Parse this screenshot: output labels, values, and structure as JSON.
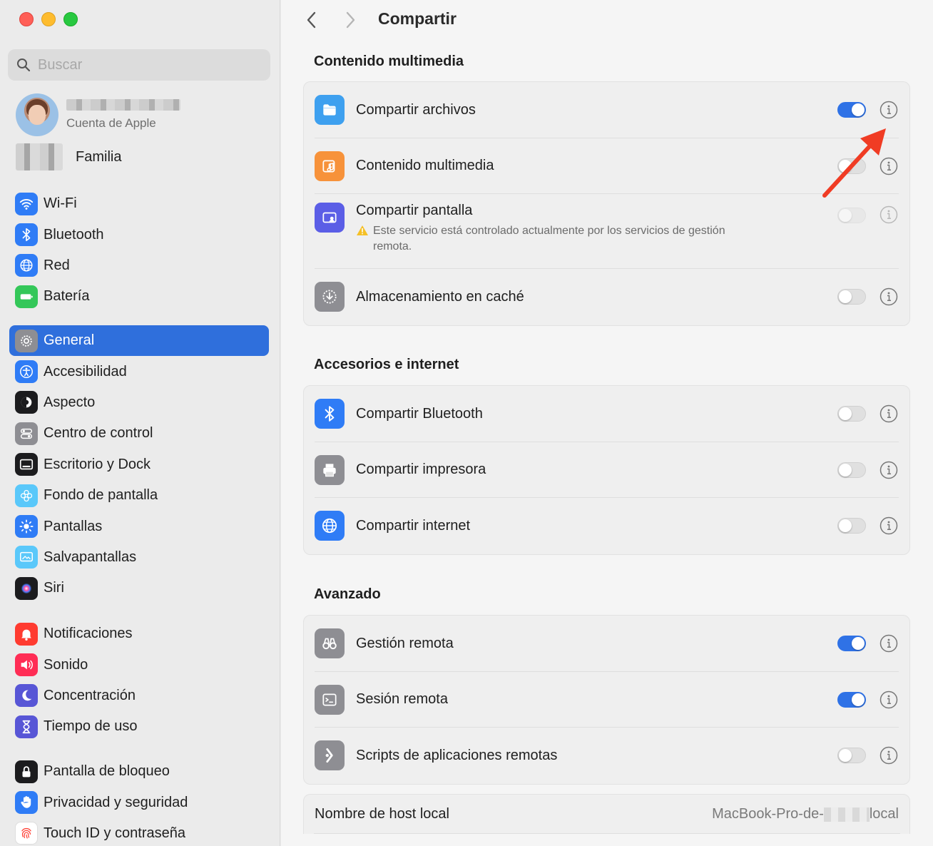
{
  "window": {
    "title": "Compartir"
  },
  "sidebar": {
    "search_placeholder": "Buscar",
    "account": {
      "subtitle": "Cuenta de Apple"
    },
    "family_label": "Familia",
    "groups": [
      [
        {
          "label": "Wi-Fi",
          "icon": "wifi-icon",
          "color": "#2f7cf6"
        },
        {
          "label": "Bluetooth",
          "icon": "bluetooth-icon",
          "color": "#2f7cf6"
        },
        {
          "label": "Red",
          "icon": "globe-icon",
          "color": "#2f7cf6"
        },
        {
          "label": "Batería",
          "icon": "battery-icon",
          "color": "#34c759"
        }
      ],
      [
        {
          "label": "General",
          "icon": "gear-icon",
          "color": "#8e8e93",
          "active": true
        },
        {
          "label": "Accesibilidad",
          "icon": "accessibility-icon",
          "color": "#2f7cf6"
        },
        {
          "label": "Aspecto",
          "icon": "appearance-icon",
          "color": "#1c1c1e"
        },
        {
          "label": "Centro de control",
          "icon": "control-center-icon",
          "color": "#8e8e93"
        },
        {
          "label": "Escritorio y Dock",
          "icon": "dock-icon",
          "color": "#1c1c1e"
        },
        {
          "label": "Fondo de pantalla",
          "icon": "wallpaper-icon",
          "color": "#5ac8fa"
        },
        {
          "label": "Pantallas",
          "icon": "brightness-icon",
          "color": "#2f7cf6"
        },
        {
          "label": "Salvapantallas",
          "icon": "screensaver-icon",
          "color": "#5ac8fa"
        },
        {
          "label": "Siri",
          "icon": "siri-icon",
          "color": "#1c1c1e"
        }
      ],
      [
        {
          "label": "Notificaciones",
          "icon": "bell-icon",
          "color": "#ff3b30"
        },
        {
          "label": "Sonido",
          "icon": "speaker-icon",
          "color": "#ff2d55"
        },
        {
          "label": "Concentración",
          "icon": "moon-icon",
          "color": "#5856d6"
        },
        {
          "label": "Tiempo de uso",
          "icon": "hourglass-icon",
          "color": "#5856d6"
        }
      ],
      [
        {
          "label": "Pantalla de bloqueo",
          "icon": "lock-icon",
          "color": "#1c1c1e"
        },
        {
          "label": "Privacidad y seguridad",
          "icon": "hand-icon",
          "color": "#2f7cf6"
        },
        {
          "label": "Touch ID y contraseña",
          "icon": "fingerprint-icon",
          "color": "#ffffff"
        }
      ]
    ]
  },
  "main": {
    "title": "Compartir",
    "sections": [
      {
        "title": "Contenido multimedia",
        "rows": [
          {
            "label": "Compartir archivos",
            "icon": "folder-icon",
            "color": "#3ea0ef",
            "toggle": true,
            "disabled": false
          },
          {
            "label": "Contenido multimedia",
            "icon": "media-icon",
            "color": "#f7923a",
            "toggle": false,
            "disabled": false
          },
          {
            "label": "Compartir pantalla",
            "icon": "screen-share-icon",
            "color": "#5b5ee6",
            "toggle": false,
            "disabled": true,
            "warning": "Este servicio está controlado actualmente por los servicios de gestión remota."
          },
          {
            "label": "Almacenamiento en caché",
            "icon": "cache-icon",
            "color": "#8e8e93",
            "toggle": false,
            "disabled": false
          }
        ]
      },
      {
        "title": "Accesorios e internet",
        "rows": [
          {
            "label": "Compartir Bluetooth",
            "icon": "bluetooth-icon",
            "color": "#2f7cf6",
            "toggle": false,
            "disabled": false
          },
          {
            "label": "Compartir impresora",
            "icon": "printer-icon",
            "color": "#8e8e93",
            "toggle": false,
            "disabled": false
          },
          {
            "label": "Compartir internet",
            "icon": "globe-icon",
            "color": "#2f7cf6",
            "toggle": false,
            "disabled": false
          }
        ]
      },
      {
        "title": "Avanzado",
        "rows": [
          {
            "label": "Gestión remota",
            "icon": "binoculars-icon",
            "color": "#8e8e93",
            "toggle": true,
            "disabled": false
          },
          {
            "label": "Sesión remota",
            "icon": "terminal-icon",
            "color": "#8e8e93",
            "toggle": true,
            "disabled": false
          },
          {
            "label": "Scripts de aplicaciones remotas",
            "icon": "script-icon",
            "color": "#8e8e93",
            "toggle": false,
            "disabled": false
          }
        ]
      }
    ],
    "host": {
      "label": "Nombre de host local",
      "value_prefix": "MacBook-Pro-de-",
      "value_suffix": "local"
    }
  },
  "annotation": {
    "icon": "red-arrow-icon",
    "color": "#f03c24"
  }
}
